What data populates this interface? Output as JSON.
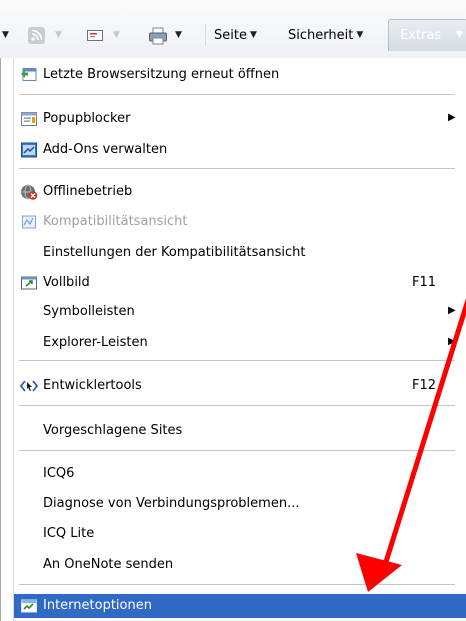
{
  "toolbar": {
    "seite_label": "Seite",
    "sicherheit_label": "Sicherheit",
    "extras_label": "Extras"
  },
  "menu": {
    "items": [
      {
        "label": "Letzte Browsersitzung erneut öffnen",
        "icon": "restore-session-icon"
      },
      {
        "label": "Popupblocker",
        "icon": "popup-blocker-icon",
        "submenu": true
      },
      {
        "label": "Add-Ons verwalten",
        "icon": "addons-icon"
      },
      {
        "label": "Offlinebetrieb",
        "icon": "offline-icon"
      },
      {
        "label": "Kompatibilitätsansicht",
        "icon": "compatibility-icon",
        "disabled": true
      },
      {
        "label": "Einstellungen der Kompatibilitätsansicht"
      },
      {
        "label": "Vollbild",
        "icon": "fullscreen-icon",
        "shortcut": "F11"
      },
      {
        "label": "Symbolleisten",
        "submenu": true
      },
      {
        "label": "Explorer-Leisten",
        "submenu": true
      },
      {
        "label": "Entwicklertools",
        "icon": "devtools-icon",
        "shortcut": "F12"
      },
      {
        "label": "Vorgeschlagene Sites"
      },
      {
        "label": "ICQ6"
      },
      {
        "label": "Diagnose von Verbindungsproblemen..."
      },
      {
        "label": "ICQ Lite"
      },
      {
        "label": "An OneNote senden"
      },
      {
        "label": "Internetoptionen",
        "icon": "internet-options-icon",
        "selected": true
      }
    ]
  },
  "colors": {
    "selection": "#316ac5",
    "annotation_arrow": "#ff0000"
  }
}
